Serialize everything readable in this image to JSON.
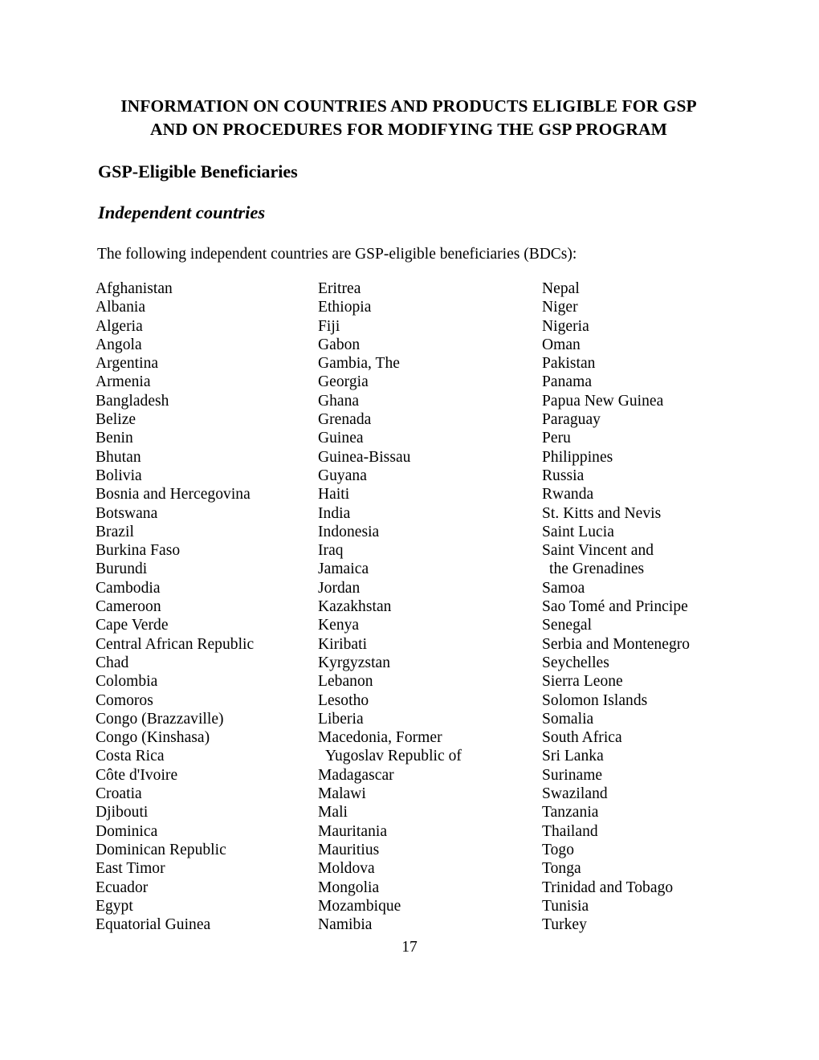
{
  "document": {
    "title_lines": [
      "INFORMATION ON COUNTRIES AND PRODUCTS ELIGIBLE FOR GSP",
      "AND ON PROCEDURES FOR MODIFYING THE GSP PROGRAM"
    ],
    "heading_1": "GSP-Eligible Beneficiaries",
    "heading_2": "Independent countries",
    "intro_paragraph": "The following independent countries are GSP-eligible beneficiaries (BDCs):",
    "page_number": "17"
  },
  "country_columns": [
    {
      "column_name": "column-1",
      "items": [
        {
          "text": "Afghanistan",
          "continuation": false
        },
        {
          "text": "Albania",
          "continuation": false
        },
        {
          "text": "Algeria",
          "continuation": false
        },
        {
          "text": "Angola",
          "continuation": false
        },
        {
          "text": "Argentina",
          "continuation": false
        },
        {
          "text": "Armenia",
          "continuation": false
        },
        {
          "text": "Bangladesh",
          "continuation": false
        },
        {
          "text": "Belize",
          "continuation": false
        },
        {
          "text": "Benin",
          "continuation": false
        },
        {
          "text": "Bhutan",
          "continuation": false
        },
        {
          "text": "Bolivia",
          "continuation": false
        },
        {
          "text": "Bosnia and Hercegovina",
          "continuation": false
        },
        {
          "text": "Botswana",
          "continuation": false
        },
        {
          "text": "Brazil",
          "continuation": false
        },
        {
          "text": "Burkina Faso",
          "continuation": false
        },
        {
          "text": "Burundi",
          "continuation": false
        },
        {
          "text": "Cambodia",
          "continuation": false
        },
        {
          "text": "Cameroon",
          "continuation": false
        },
        {
          "text": "Cape Verde",
          "continuation": false
        },
        {
          "text": "Central African Republic",
          "continuation": false
        },
        {
          "text": "Chad",
          "continuation": false
        },
        {
          "text": "Colombia",
          "continuation": false
        },
        {
          "text": "Comoros",
          "continuation": false
        },
        {
          "text": "Congo (Brazzaville)",
          "continuation": false
        },
        {
          "text": "Congo (Kinshasa)",
          "continuation": false
        },
        {
          "text": "Costa Rica",
          "continuation": false
        },
        {
          "text": "Côte d'Ivoire",
          "continuation": false
        },
        {
          "text": "Croatia",
          "continuation": false
        },
        {
          "text": "Djibouti",
          "continuation": false
        },
        {
          "text": "Dominica",
          "continuation": false
        },
        {
          "text": "Dominican Republic",
          "continuation": false
        },
        {
          "text": "East Timor",
          "continuation": false
        },
        {
          "text": "Ecuador",
          "continuation": false
        },
        {
          "text": "Egypt",
          "continuation": false
        },
        {
          "text": "Equatorial Guinea",
          "continuation": false
        }
      ]
    },
    {
      "column_name": "column-2",
      "items": [
        {
          "text": "Eritrea",
          "continuation": false
        },
        {
          "text": "Ethiopia",
          "continuation": false
        },
        {
          "text": "Fiji",
          "continuation": false
        },
        {
          "text": "Gabon",
          "continuation": false
        },
        {
          "text": "Gambia, The",
          "continuation": false
        },
        {
          "text": "Georgia",
          "continuation": false
        },
        {
          "text": "Ghana",
          "continuation": false
        },
        {
          "text": "Grenada",
          "continuation": false
        },
        {
          "text": "Guinea",
          "continuation": false
        },
        {
          "text": "Guinea-Bissau",
          "continuation": false
        },
        {
          "text": "Guyana",
          "continuation": false
        },
        {
          "text": "Haiti",
          "continuation": false
        },
        {
          "text": "India",
          "continuation": false
        },
        {
          "text": "Indonesia",
          "continuation": false
        },
        {
          "text": "Iraq",
          "continuation": false
        },
        {
          "text": "Jamaica",
          "continuation": false
        },
        {
          "text": "Jordan",
          "continuation": false
        },
        {
          "text": "Kazakhstan",
          "continuation": false
        },
        {
          "text": "Kenya",
          "continuation": false
        },
        {
          "text": "Kiribati",
          "continuation": false
        },
        {
          "text": "Kyrgyzstan",
          "continuation": false
        },
        {
          "text": "Lebanon",
          "continuation": false
        },
        {
          "text": "Lesotho",
          "continuation": false
        },
        {
          "text": "Liberia",
          "continuation": false
        },
        {
          "text": "Macedonia, Former",
          "continuation": false
        },
        {
          "text": "Yugoslav Republic of",
          "continuation": true
        },
        {
          "text": "Madagascar",
          "continuation": false
        },
        {
          "text": "Malawi",
          "continuation": false
        },
        {
          "text": "Mali",
          "continuation": false
        },
        {
          "text": "Mauritania",
          "continuation": false
        },
        {
          "text": "Mauritius",
          "continuation": false
        },
        {
          "text": "Moldova",
          "continuation": false
        },
        {
          "text": "Mongolia",
          "continuation": false
        },
        {
          "text": "Mozambique",
          "continuation": false
        },
        {
          "text": "Namibia",
          "continuation": false
        }
      ]
    },
    {
      "column_name": "column-3",
      "items": [
        {
          "text": "Nepal",
          "continuation": false
        },
        {
          "text": "Niger",
          "continuation": false
        },
        {
          "text": "Nigeria",
          "continuation": false
        },
        {
          "text": "Oman",
          "continuation": false
        },
        {
          "text": "Pakistan",
          "continuation": false
        },
        {
          "text": "Panama",
          "continuation": false
        },
        {
          "text": "Papua New Guinea",
          "continuation": false
        },
        {
          "text": "Paraguay",
          "continuation": false
        },
        {
          "text": "Peru",
          "continuation": false
        },
        {
          "text": "Philippines",
          "continuation": false
        },
        {
          "text": "Russia",
          "continuation": false
        },
        {
          "text": "Rwanda",
          "continuation": false
        },
        {
          "text": "St. Kitts and Nevis",
          "continuation": false
        },
        {
          "text": "Saint Lucia",
          "continuation": false
        },
        {
          "text": "Saint Vincent and",
          "continuation": false
        },
        {
          "text": "the Grenadines",
          "continuation": true
        },
        {
          "text": "Samoa",
          "continuation": false
        },
        {
          "text": "Sao Tomé and Principe",
          "continuation": false
        },
        {
          "text": "Senegal",
          "continuation": false
        },
        {
          "text": "Serbia and Montenegro",
          "continuation": false
        },
        {
          "text": "Seychelles",
          "continuation": false
        },
        {
          "text": "Sierra Leone",
          "continuation": false
        },
        {
          "text": "Solomon Islands",
          "continuation": false
        },
        {
          "text": "Somalia",
          "continuation": false
        },
        {
          "text": "South Africa",
          "continuation": false
        },
        {
          "text": "Sri Lanka",
          "continuation": false
        },
        {
          "text": "Suriname",
          "continuation": false
        },
        {
          "text": "Swaziland",
          "continuation": false
        },
        {
          "text": "Tanzania",
          "continuation": false
        },
        {
          "text": "Thailand",
          "continuation": false
        },
        {
          "text": "Togo",
          "continuation": false
        },
        {
          "text": "Tonga",
          "continuation": false
        },
        {
          "text": "Trinidad and Tobago",
          "continuation": false
        },
        {
          "text": "Tunisia",
          "continuation": false
        },
        {
          "text": "Turkey",
          "continuation": false
        }
      ]
    }
  ]
}
